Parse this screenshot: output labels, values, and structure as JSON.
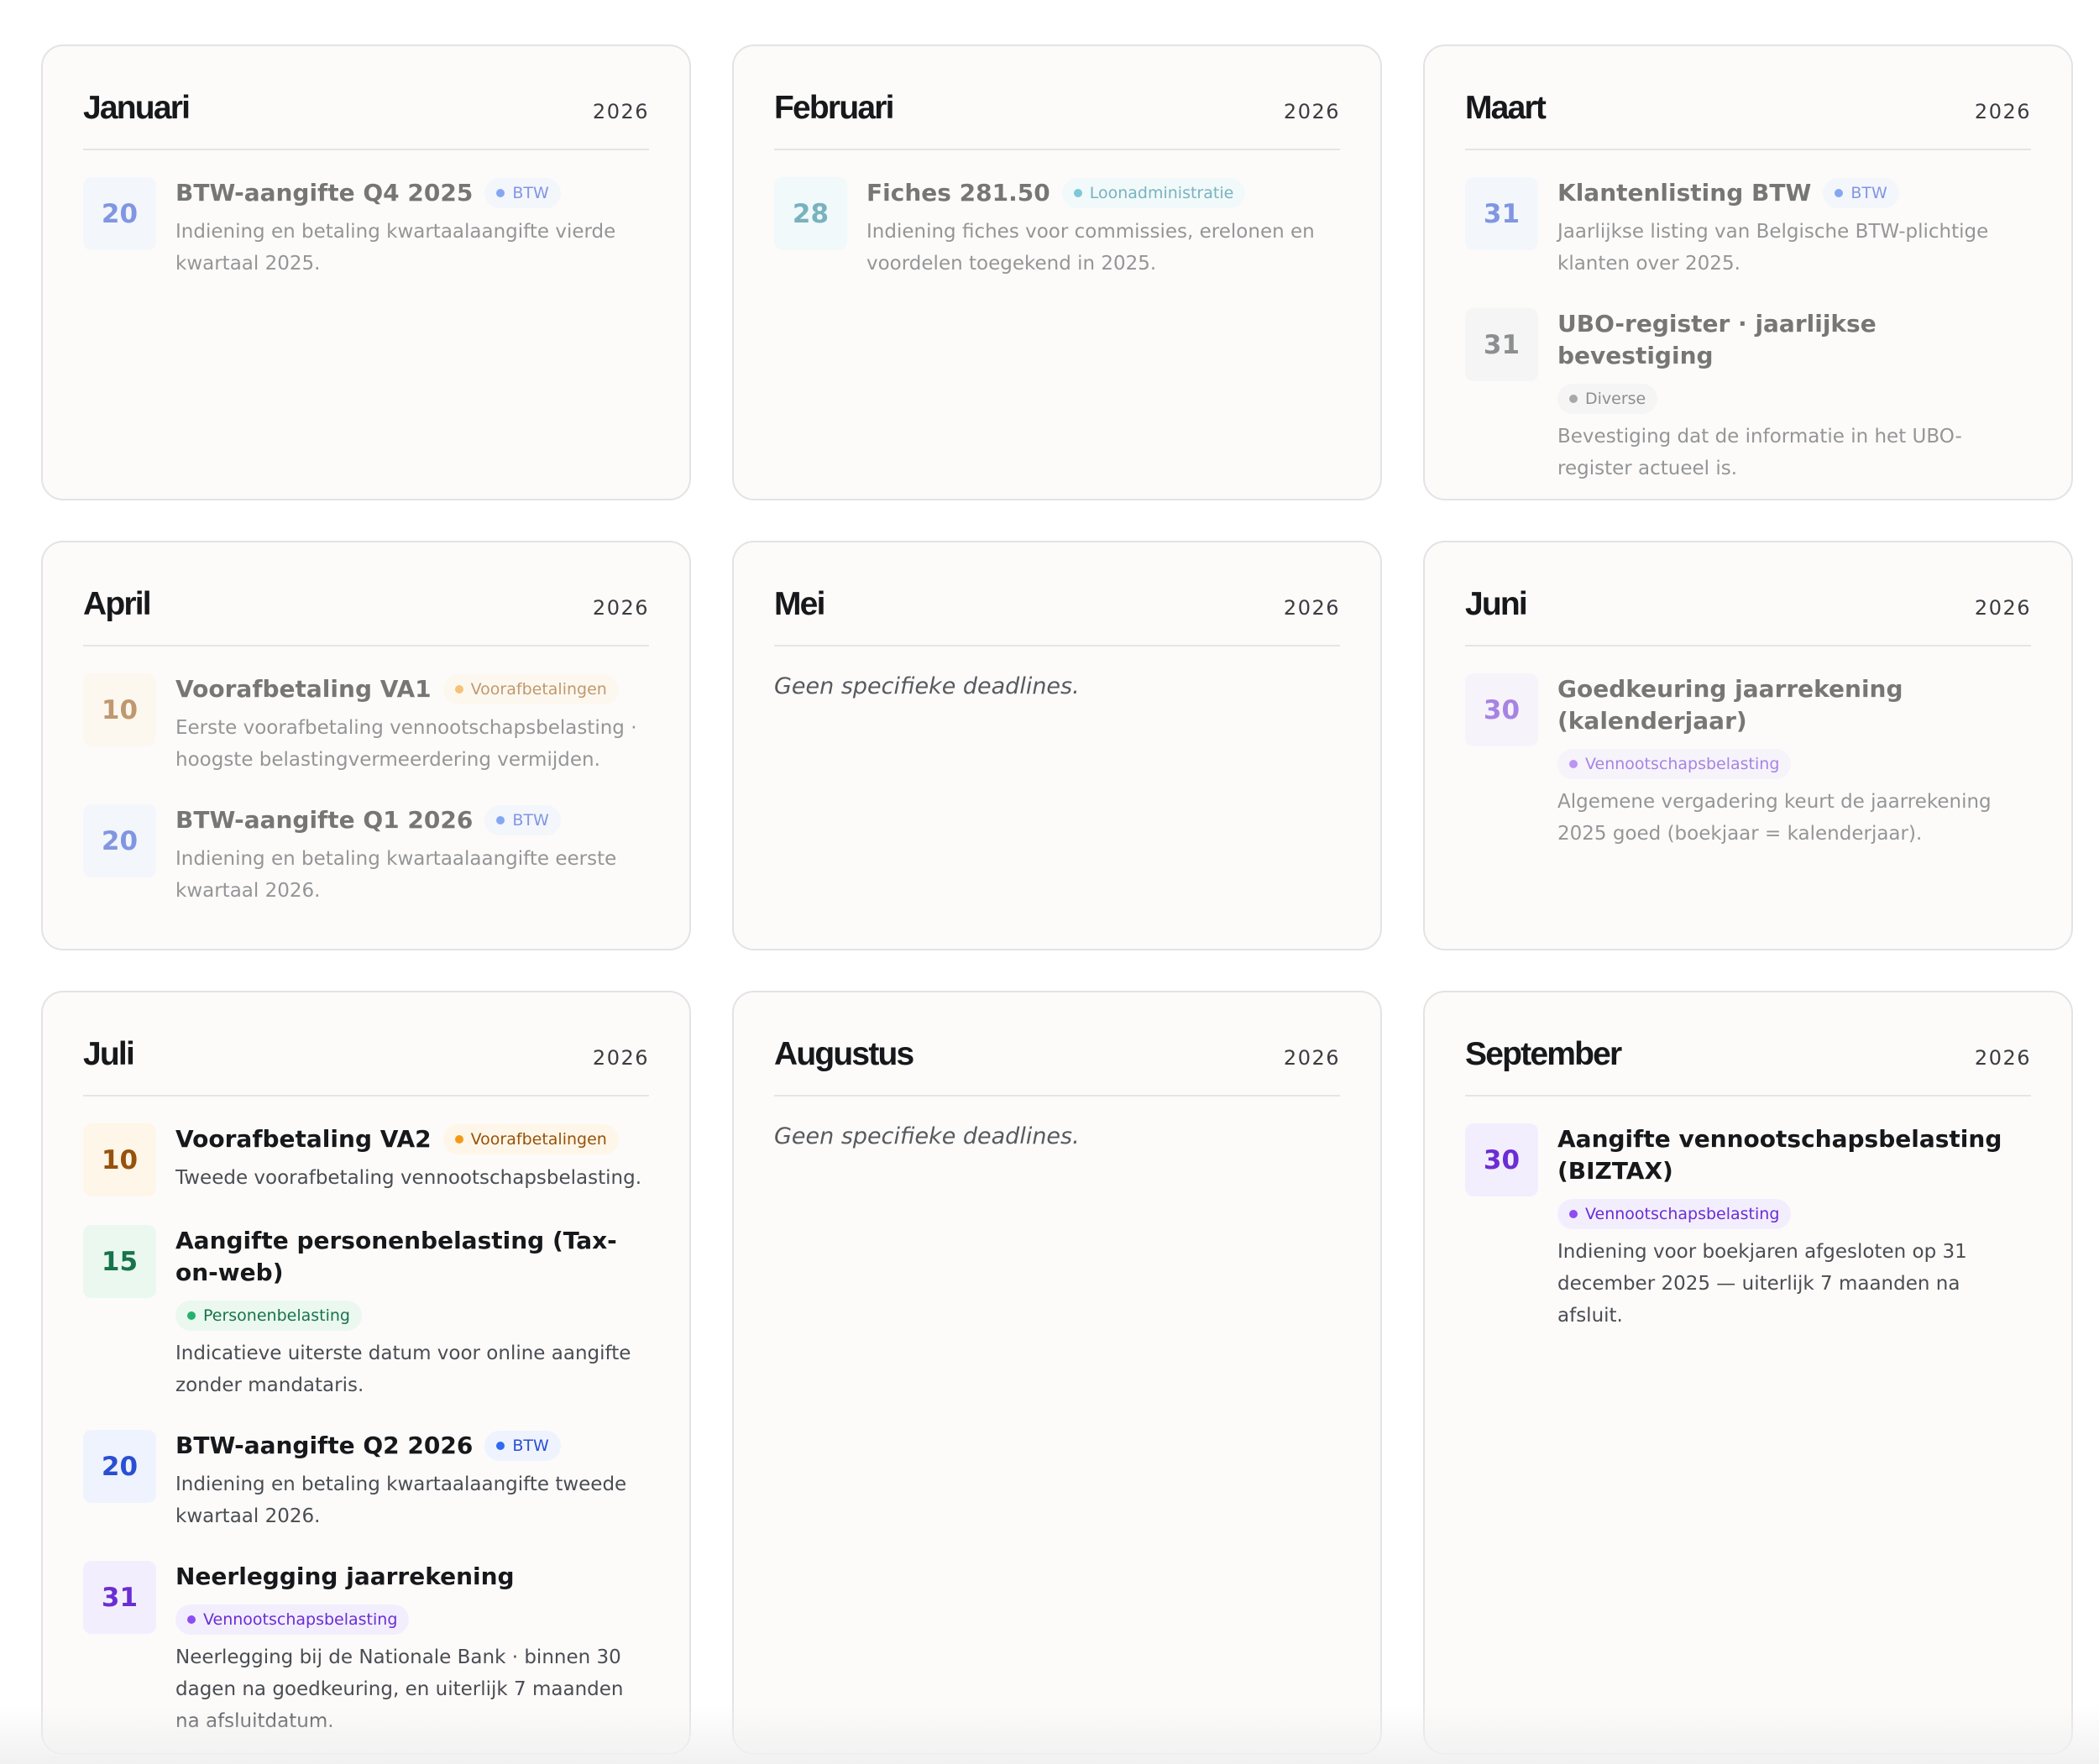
{
  "empty_text": "Geen specifieke deadlines.",
  "colors": {
    "btw": "#2a4fd3",
    "loonadministratie": "#1b7f95",
    "diverse": "#3e4046",
    "voorafbetalingen": "#96520c",
    "vennootschapsbelasting": "#6a2ed4",
    "personenbelasting": "#18734a"
  },
  "months": [
    {
      "name": "Januari",
      "year": "2026",
      "muted": true,
      "items": [
        {
          "day": "20",
          "title": "BTW-aangifte Q4 2025",
          "category": "btw",
          "badge": "BTW",
          "description": "Indiening en betaling kwartaalaangifte vierde kwartaal 2025."
        }
      ]
    },
    {
      "name": "Februari",
      "year": "2026",
      "muted": true,
      "items": [
        {
          "day": "28",
          "title": "Fiches 281.50",
          "category": "loon",
          "badge": "Loonadministratie",
          "description": "Indiening fiches voor commissies, erelonen en voordelen toegekend in 2025."
        }
      ]
    },
    {
      "name": "Maart",
      "year": "2026",
      "muted": true,
      "items": [
        {
          "day": "31",
          "title": "Klantenlisting BTW",
          "category": "btw",
          "badge": "BTW",
          "description": "Jaarlijkse listing van Belgische BTW-plichtige klanten over 2025."
        },
        {
          "day": "31",
          "title": "UBO-register · jaarlijkse bevestiging",
          "category": "div",
          "badge": "Diverse",
          "description": "Bevestiging dat de informatie in het UBO-register actueel is."
        }
      ]
    },
    {
      "name": "April",
      "year": "2026",
      "muted": true,
      "items": [
        {
          "day": "10",
          "title": "Voorafbetaling VA1",
          "category": "voor",
          "badge": "Voorafbetalingen",
          "description": "Eerste voorafbetaling vennootschapsbelasting · hoogste belastingvermeerdering vermijden."
        },
        {
          "day": "20",
          "title": "BTW-aangifte Q1 2026",
          "category": "btw",
          "badge": "BTW",
          "description": "Indiening en betaling kwartaalaangifte eerste kwartaal 2026."
        }
      ]
    },
    {
      "name": "Mei",
      "year": "2026",
      "muted": false,
      "items": []
    },
    {
      "name": "Juni",
      "year": "2026",
      "muted": true,
      "items": [
        {
          "day": "30",
          "title": "Goedkeuring jaarrekening (kalenderjaar)",
          "category": "vpb",
          "badge": "Vennootschapsbelasting",
          "description": "Algemene vergadering keurt de jaarrekening 2025 goed (boekjaar = kalenderjaar)."
        }
      ]
    },
    {
      "name": "Juli",
      "year": "2026",
      "muted": false,
      "items": [
        {
          "day": "10",
          "title": "Voorafbetaling VA2",
          "category": "voor",
          "badge": "Voorafbetalingen",
          "description": "Tweede voorafbetaling vennootschapsbelasting."
        },
        {
          "day": "15",
          "title": "Aangifte personenbelasting (Tax-on-web)",
          "category": "pers",
          "badge": "Personenbelasting",
          "description": "Indicatieve uiterste datum voor online aangifte zonder mandataris."
        },
        {
          "day": "20",
          "title": "BTW-aangifte Q2 2026",
          "category": "btw",
          "badge": "BTW",
          "description": "Indiening en betaling kwartaalaangifte tweede kwartaal 2026."
        },
        {
          "day": "31",
          "title": "Neerlegging jaarrekening",
          "category": "vpb",
          "badge": "Vennootschapsbelasting",
          "description": "Neerlegging bij de Nationale Bank · binnen 30 dagen na goedkeuring, en uiterlijk 7 maanden na afsluitdatum."
        }
      ]
    },
    {
      "name": "Augustus",
      "year": "2026",
      "muted": false,
      "items": []
    },
    {
      "name": "September",
      "year": "2026",
      "muted": false,
      "items": [
        {
          "day": "30",
          "title": "Aangifte vennootschapsbelasting (BIZTAX)",
          "category": "vpb",
          "badge": "Vennootschapsbelasting",
          "description": "Indiening voor boekjaren afgesloten op 31 december 2025 — uiterlijk 7 maanden na afsluit."
        }
      ]
    }
  ]
}
